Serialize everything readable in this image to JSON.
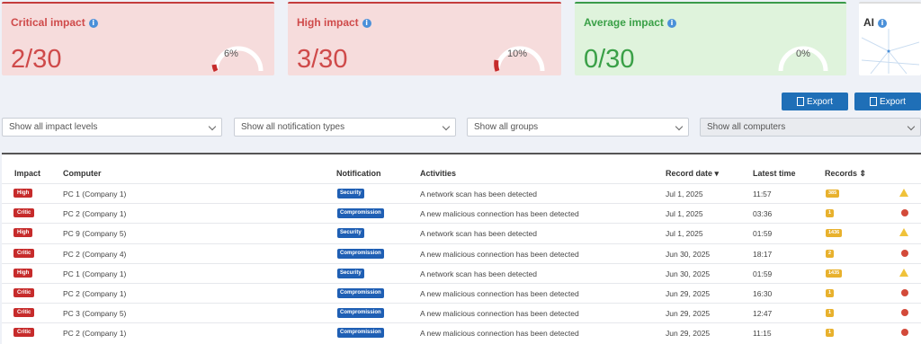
{
  "cards": {
    "critical": {
      "title": "Critical impact",
      "value": "2/30",
      "percent": "6%"
    },
    "high": {
      "title": "High impact",
      "value": "3/30",
      "percent": "10%"
    },
    "average": {
      "title": "Average impact",
      "value": "0/30",
      "percent": "0%"
    },
    "ai": {
      "title": "AI"
    }
  },
  "toolbar": {
    "export1_label": "Export",
    "export2_label": "Export"
  },
  "filters": {
    "impact": "Show all impact levels",
    "notification": "Show all notification types",
    "groups": "Show all groups",
    "computers": "Show all computers"
  },
  "table": {
    "headers": {
      "impact": "Impact",
      "computer": "Computer",
      "notification": "Notification",
      "activities": "Activities",
      "record_date": "Record date",
      "latest_time": "Latest time",
      "records": "Records"
    },
    "rows": [
      {
        "impact": "High",
        "computer": "PC 1 (Company 1)",
        "notification": "Security",
        "activity": "A network scan has been detected",
        "date": "Jul 1, 2025",
        "time": "11:57",
        "records": "385",
        "icon": "warning-icon"
      },
      {
        "impact": "Critic",
        "computer": "PC 2 (Company 1)",
        "notification": "Compromission",
        "activity": "A new malicious connection has been detected",
        "date": "Jul 1, 2025",
        "time": "03:36",
        "records": "1",
        "icon": "bomb-icon"
      },
      {
        "impact": "High",
        "computer": "PC 9 (Company 5)",
        "notification": "Security",
        "activity": "A network scan has been detected",
        "date": "Jul 1, 2025",
        "time": "01:59",
        "records": "1436",
        "icon": "warning-icon"
      },
      {
        "impact": "Critic",
        "computer": "PC 2 (Company 4)",
        "notification": "Compromission",
        "activity": "A new malicious connection has been detected",
        "date": "Jun 30, 2025",
        "time": "18:17",
        "records": "2",
        "icon": "bomb-icon"
      },
      {
        "impact": "High",
        "computer": "PC 1 (Company 1)",
        "notification": "Security",
        "activity": "A network scan has been detected",
        "date": "Jun 30, 2025",
        "time": "01:59",
        "records": "1435",
        "icon": "warning-icon"
      },
      {
        "impact": "Critic",
        "computer": "PC 2 (Company 1)",
        "notification": "Compromission",
        "activity": "A new malicious connection has been detected",
        "date": "Jun 29, 2025",
        "time": "16:30",
        "records": "1",
        "icon": "bomb-icon"
      },
      {
        "impact": "Critic",
        "computer": "PC 3 (Company 5)",
        "notification": "Compromission",
        "activity": "A new malicious connection has been detected",
        "date": "Jun 29, 2025",
        "time": "12:47",
        "records": "1",
        "icon": "bomb-icon"
      },
      {
        "impact": "Critic",
        "computer": "PC 2 (Company 1)",
        "notification": "Compromission",
        "activity": "A new malicious connection has been detected",
        "date": "Jun 29, 2025",
        "time": "11:15",
        "records": "1",
        "icon": "bomb-icon"
      }
    ]
  },
  "colors": {
    "critical": "#c62b2b",
    "accent": "#1f6fb7",
    "records": "#e8b12d",
    "average": "#3aa047"
  }
}
